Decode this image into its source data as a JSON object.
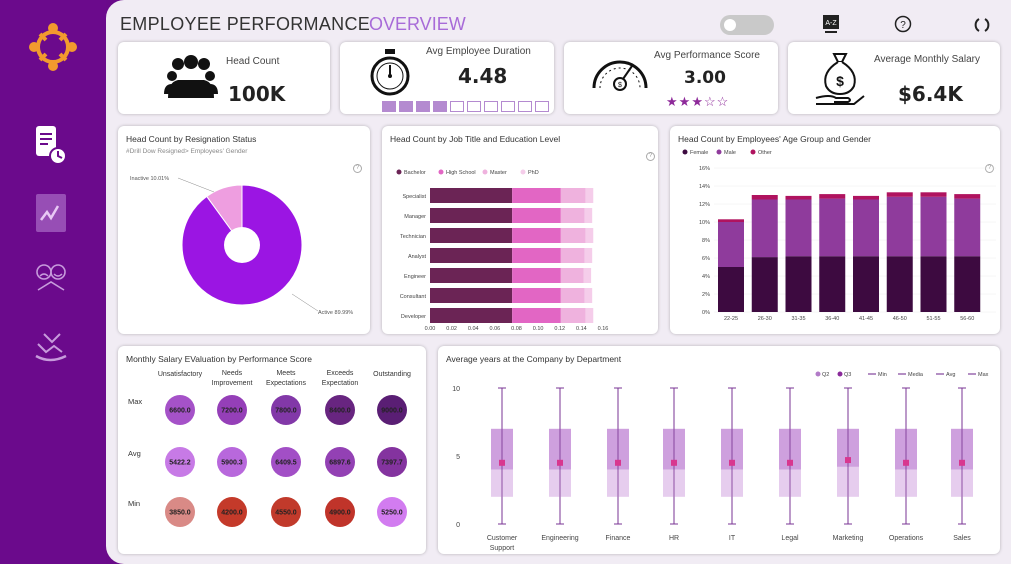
{
  "header": {
    "title": "EMPLOYEE PERFORMANCE",
    "subtitle": "OVERVIEW"
  },
  "kpis": {
    "head_count": {
      "label": "Head Count",
      "value": "100K"
    },
    "duration": {
      "label": "Avg Employee Duration",
      "value": "4.48",
      "progress_filled": 4,
      "progress_total": 10
    },
    "score": {
      "label": "Avg Performance Score",
      "value": "3.00",
      "stars": 3,
      "stars_total": 5
    },
    "salary": {
      "label": "Average Monthly Salary",
      "value": "$6.4K"
    }
  },
  "colors": {
    "purple": "#9b15e3",
    "pink": "#ee9ee0",
    "dark": "#6b2455",
    "mid": "#e266c4",
    "light": "#efb2de",
    "lighter": "#f5cdea",
    "sidebar": "#6b0a8c"
  },
  "chart_data": [
    {
      "type": "pie",
      "title": "Head Count by Resignation Status",
      "subtitle": "#Drill Dow Resigned> Employees' Gender",
      "categories": [
        "Inactive",
        "Active"
      ],
      "labels": [
        "Inactive 10.01%",
        "Active 89.99%"
      ],
      "values": [
        10.01,
        89.99
      ]
    },
    {
      "type": "bar",
      "orientation": "horizontal",
      "stacked": true,
      "title": "Head Count by Job Title and Education Level",
      "categories": [
        "Specialist",
        "Manager",
        "Technician",
        "Analyst",
        "Engineer",
        "Consultant",
        "Developer"
      ],
      "series": [
        {
          "name": "Bachelor",
          "values": [
            0.076,
            0.076,
            0.076,
            0.076,
            0.076,
            0.076,
            0.076
          ]
        },
        {
          "name": "High School",
          "values": [
            0.045,
            0.045,
            0.045,
            0.045,
            0.045,
            0.045,
            0.045
          ]
        },
        {
          "name": "Master",
          "values": [
            0.023,
            0.022,
            0.023,
            0.022,
            0.021,
            0.022,
            0.023
          ]
        },
        {
          "name": "PhD",
          "values": [
            0.007,
            0.007,
            0.007,
            0.007,
            0.007,
            0.007,
            0.007
          ]
        }
      ],
      "xticks": [
        "0.00",
        "0.02",
        "0.04",
        "0.06",
        "0.08",
        "0.10",
        "0.12",
        "0.14",
        "0.16"
      ],
      "xlim": [
        0,
        0.16
      ]
    },
    {
      "type": "bar",
      "stacked": true,
      "title": "Head Count by Employees' Age Group and Gender",
      "categories": [
        "22-25",
        "26-30",
        "31-35",
        "36-40",
        "41-45",
        "46-50",
        "51-55",
        "56-60"
      ],
      "series": [
        {
          "name": "Female",
          "values": [
            5.0,
            6.1,
            6.2,
            6.2,
            6.2,
            6.2,
            6.2,
            6.2
          ]
        },
        {
          "name": "Male",
          "values": [
            5.0,
            6.4,
            6.3,
            6.4,
            6.3,
            6.6,
            6.6,
            6.4
          ]
        },
        {
          "name": "Other",
          "values": [
            0.3,
            0.5,
            0.4,
            0.5,
            0.4,
            0.5,
            0.5,
            0.5
          ]
        }
      ],
      "yticks": [
        "0%",
        "2%",
        "4%",
        "6%",
        "8%",
        "10%",
        "12%",
        "14%",
        "16%"
      ],
      "ylim": [
        0,
        16
      ]
    },
    {
      "type": "table",
      "title": "Monthly Salary EValuation by Performance Score",
      "columns": [
        "Unsatisfactory",
        "Needs Improvement",
        "Meets Expectations",
        "Exceeds Expectation",
        "Outstanding"
      ],
      "rows": [
        {
          "name": "Max",
          "values": [
            "6600.0",
            "7200.0",
            "7800.0",
            "8400.0",
            "9000.0"
          ],
          "colors": [
            "#a552c8",
            "#953fb8",
            "#8238a8",
            "#682580",
            "#5a1e74"
          ]
        },
        {
          "name": "Avg",
          "values": [
            "5422.2",
            "5900.3",
            "6409.5",
            "6897.6",
            "7397.7"
          ],
          "colors": [
            "#c77ae6",
            "#b868dc",
            "#a24fc6",
            "#9341b4",
            "#84339f"
          ]
        },
        {
          "name": "Min",
          "values": [
            "3850.0",
            "4200.0",
            "4550.0",
            "4900.0",
            "5250.0"
          ],
          "colors": [
            "#d98a86",
            "#c43a2a",
            "#c13a2b",
            "#c0342a",
            "#d27cf0"
          ]
        }
      ]
    },
    {
      "type": "box",
      "title": "Average years at the Company by Department",
      "categories": [
        "Customer Support",
        "Engineering",
        "Finance",
        "HR",
        "IT",
        "Legal",
        "Marketing",
        "Operations",
        "Sales"
      ],
      "legend": [
        "Q2",
        "Q3",
        "Min",
        "Media",
        "Avg",
        "Max"
      ],
      "min": [
        0,
        0,
        0,
        0,
        0,
        0,
        0,
        0,
        0
      ],
      "q1": [
        2,
        2,
        2,
        2,
        2,
        2,
        2,
        2,
        2
      ],
      "median": [
        4,
        4,
        4,
        4,
        4,
        4,
        4.2,
        4,
        4
      ],
      "q3": [
        7,
        7,
        7,
        7,
        7,
        7,
        7,
        7,
        7
      ],
      "max": [
        10,
        10,
        10,
        10,
        10,
        10,
        10,
        10,
        10
      ],
      "avg": [
        4.5,
        4.5,
        4.5,
        4.5,
        4.5,
        4.5,
        4.7,
        4.5,
        4.5
      ],
      "yticks": [
        "0",
        "5",
        "10"
      ],
      "ylim": [
        0,
        10
      ]
    }
  ]
}
